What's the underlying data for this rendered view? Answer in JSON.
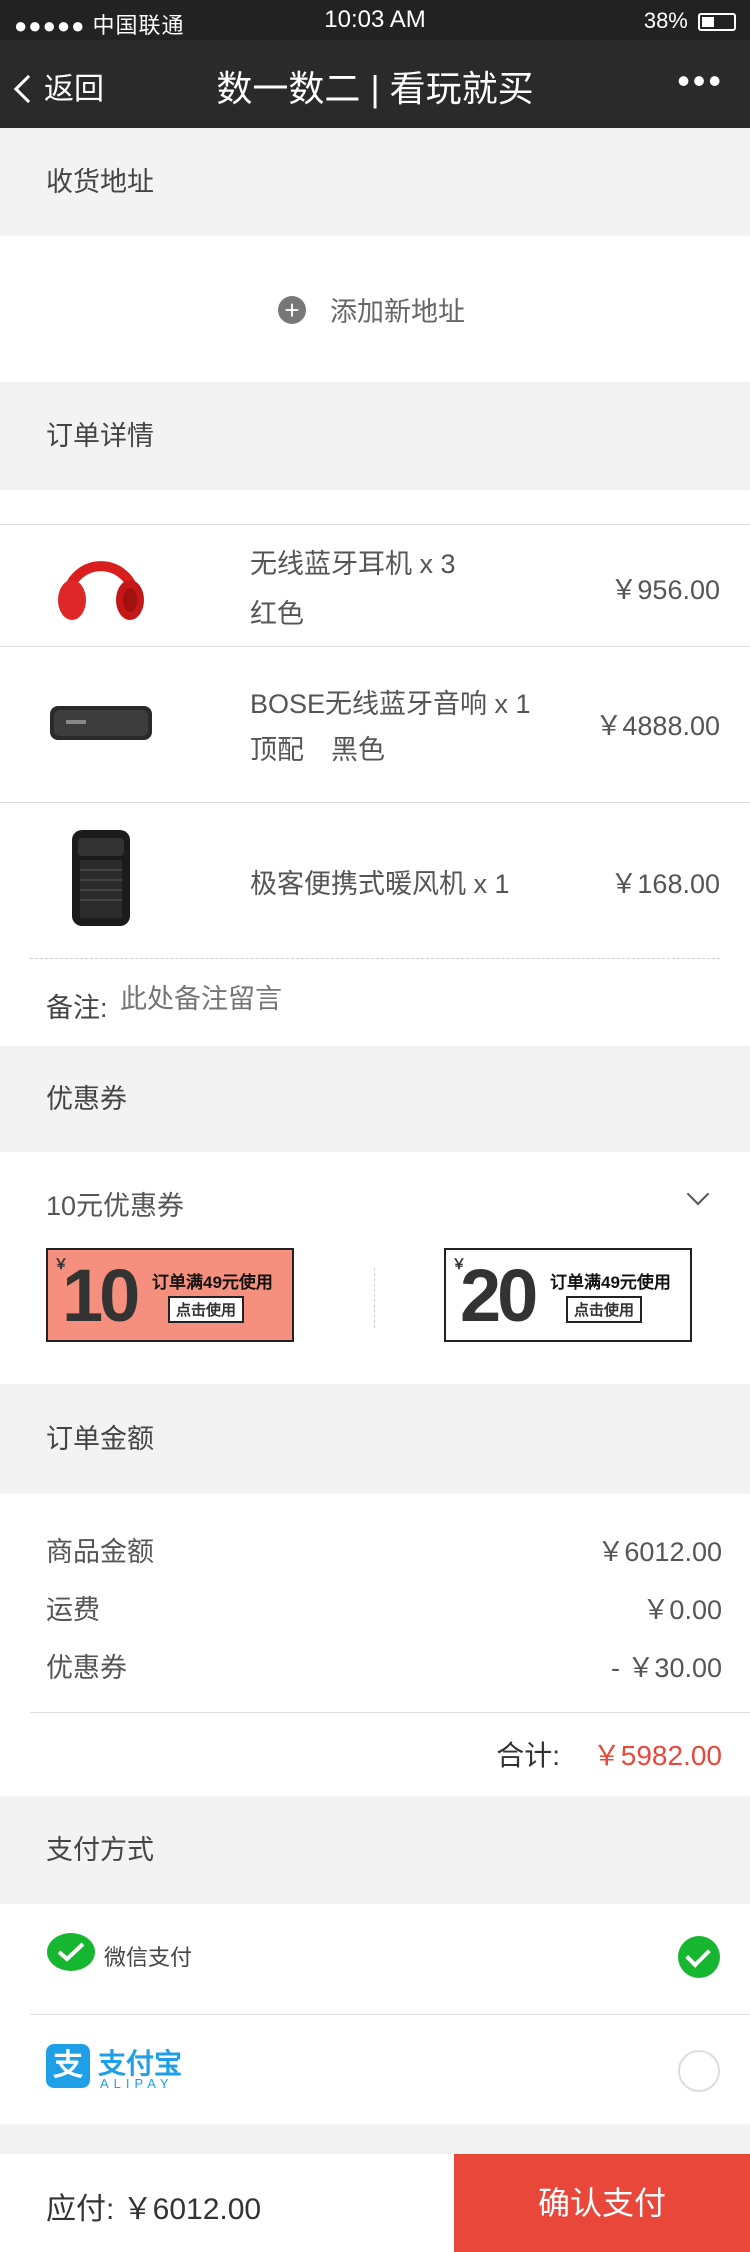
{
  "status": {
    "carrier": "●●●●● 中国联通",
    "time": "10:03 AM",
    "battery": "38%"
  },
  "nav": {
    "back_label": "返回",
    "title": "数一数二 | 看玩就买",
    "more": "•••"
  },
  "address": {
    "section_title": "收货地址",
    "add_label": "添加新地址"
  },
  "order": {
    "section_title": "订单详情",
    "items": [
      {
        "name": "无线蓝牙耳机 x 3",
        "spec": "红色",
        "price": "￥956.00"
      },
      {
        "name": "BOSE无线蓝牙音响 x 1",
        "spec": "顶配　黑色",
        "price": "￥4888.00"
      },
      {
        "name": "极客便携式暖风机 x 1",
        "spec": "",
        "price": "￥168.00"
      }
    ],
    "remark_label": "备注:",
    "remark_placeholder": "此处备注留言"
  },
  "coupons": {
    "section_title": "优惠券",
    "selected": "10元优惠券",
    "list": [
      {
        "currency": "￥",
        "amount": "10",
        "condition": "订单满49元使用",
        "use_label": "点击使用",
        "color": "#f58f7e"
      },
      {
        "currency": "￥",
        "amount": "20",
        "condition": "订单满49元使用",
        "use_label": "点击使用",
        "color": "#ffffff"
      }
    ]
  },
  "amount": {
    "section_title": "订单金额",
    "rows": [
      {
        "label": "商品金额",
        "value": "￥6012.00"
      },
      {
        "label": "运费",
        "value": "￥0.00"
      },
      {
        "label": "优惠券",
        "value": "- ￥30.00"
      }
    ],
    "total_label": "合计:",
    "total_value": "￥5982.00"
  },
  "payment": {
    "section_title": "支付方式",
    "wechat_label": "微信支付",
    "alipay_char": "支",
    "alipay_name": "支付宝",
    "alipay_sub": "ALIPAY"
  },
  "footer": {
    "due_label": "应付: ￥6012.00",
    "confirm_label": "确认支付"
  },
  "colors": {
    "accent": "#e8473a",
    "wechat_green": "#17b630",
    "alipay_blue": "#1e9fe8"
  }
}
